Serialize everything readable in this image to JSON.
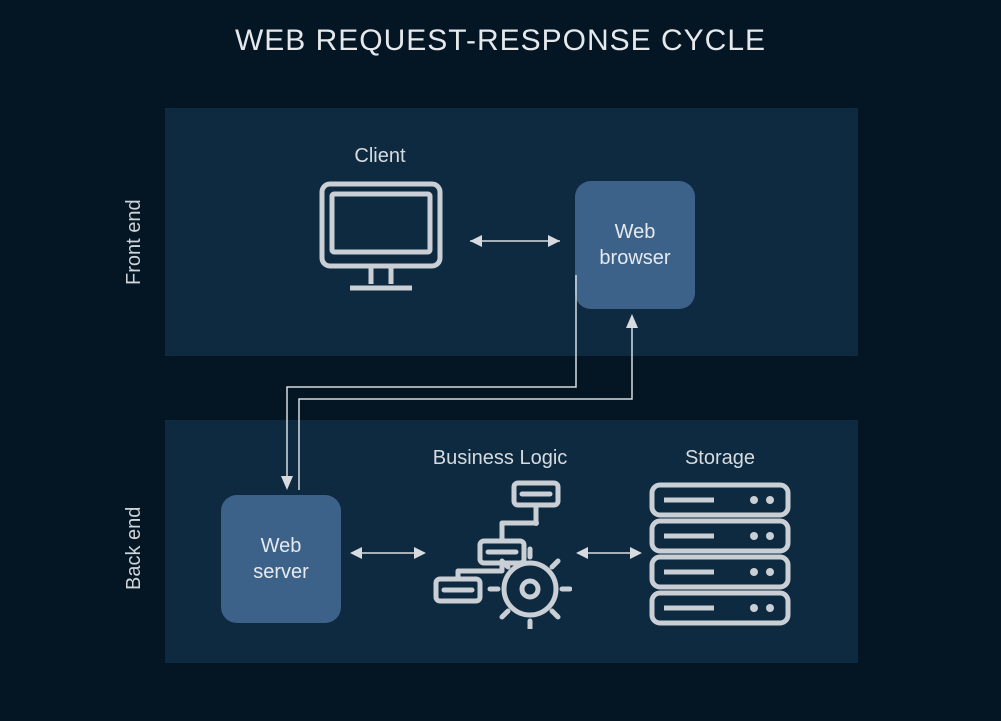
{
  "title": "WEB REQUEST-RESPONSE CYCLE",
  "sections": {
    "front": {
      "label": "Front end"
    },
    "back": {
      "label": "Back end"
    }
  },
  "nodes": {
    "client": {
      "label": "Client"
    },
    "web_browser": {
      "label": "Web\nbrowser"
    },
    "web_server": {
      "label": "Web\nserver"
    },
    "business_logic": {
      "label": "Business Logic"
    },
    "storage": {
      "label": "Storage"
    }
  },
  "icons": {
    "monitor": "monitor-icon",
    "logic": "workflow-gear-icon",
    "storage": "server-stack-icon"
  },
  "colors": {
    "bg": "#041524",
    "panel": "#0d2a40",
    "chip": "#3d628a",
    "stroke": "#d7dbdf"
  }
}
